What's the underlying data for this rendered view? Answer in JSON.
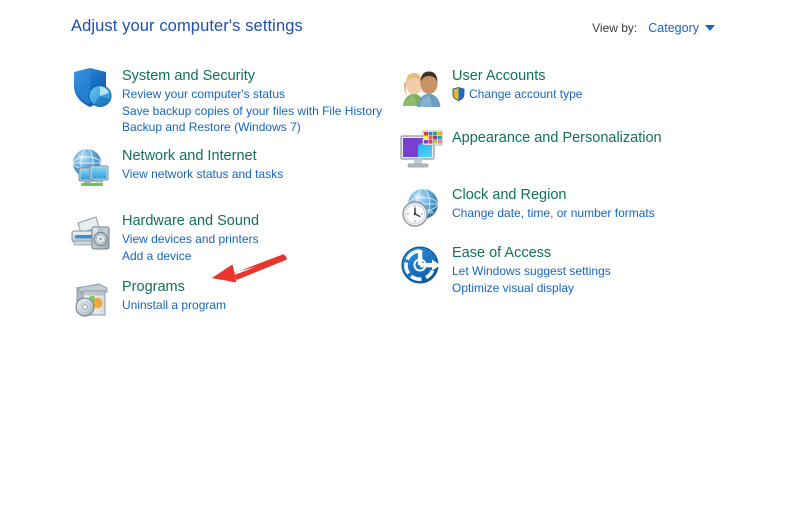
{
  "header": {
    "title": "Adjust your computer's settings",
    "view_by_label": "View by:",
    "view_by_value": "Category",
    "caret_icon": "chevron-down-icon"
  },
  "colors": {
    "title_blue": "#1c50b0",
    "category_green": "#12705a",
    "link_blue": "#1566c0",
    "annotation_red": "#e8342a",
    "background": "#ffffff"
  },
  "categories": {
    "left": [
      {
        "icon": "shield-security-icon",
        "title": "System and Security",
        "links": [
          "Review your computer's status",
          "Save backup copies of your files with File History",
          "Backup and Restore (Windows 7)"
        ]
      },
      {
        "icon": "globe-network-icon",
        "title": "Network and Internet",
        "links": [
          "View network status and tasks"
        ]
      },
      {
        "icon": "printer-hardware-icon",
        "title": "Hardware and Sound",
        "links": [
          "View devices and printers",
          "Add a device"
        ]
      },
      {
        "icon": "programs-box-icon",
        "title": "Programs",
        "links": [
          "Uninstall a program"
        ]
      }
    ],
    "right": [
      {
        "icon": "user-accounts-icon",
        "title": "User Accounts",
        "links": [
          "Change account type"
        ],
        "link_shield": true
      },
      {
        "icon": "appearance-monitor-icon",
        "title": "Appearance and Personalization",
        "links": []
      },
      {
        "icon": "clock-region-icon",
        "title": "Clock and Region",
        "links": [
          "Change date, time, or number formats"
        ]
      },
      {
        "icon": "ease-of-access-icon",
        "title": "Ease of Access",
        "links": [
          "Let Windows suggest settings",
          "Optimize visual display"
        ]
      }
    ]
  },
  "annotation": {
    "icon": "red-arrow-pointing-left",
    "points_at": "Programs"
  }
}
